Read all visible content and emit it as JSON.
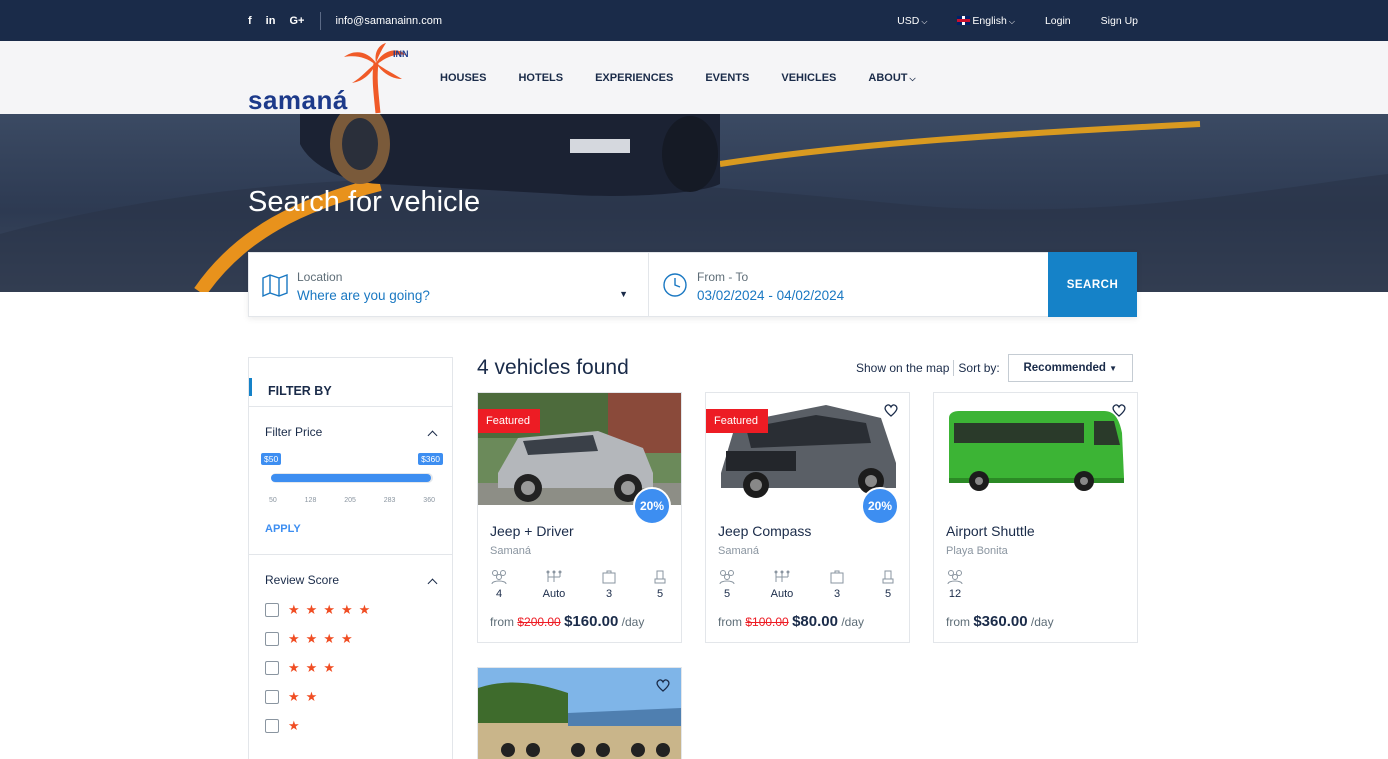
{
  "topbar": {
    "social": [
      "f",
      "in",
      "G+"
    ],
    "email": "info@samanainn.com",
    "currency": "USD",
    "language": "English",
    "login": "Login",
    "signup": "Sign Up"
  },
  "header": {
    "logo_text": "samaná",
    "logo_sup": "INN",
    "nav": [
      "HOUSES",
      "HOTELS",
      "EXPERIENCES",
      "EVENTS",
      "VEHICLES",
      "ABOUT"
    ]
  },
  "hero": {
    "title": "Search for vehicle"
  },
  "search": {
    "location_label": "Location",
    "location_value": "Where are you going?",
    "date_label": "From - To",
    "date_value": "03/02/2024 - 04/02/2024",
    "button": "SEARCH"
  },
  "sidebar": {
    "filter_by": "FILTER BY",
    "price_title": "Filter Price",
    "price_min_tag": "$50",
    "price_max_tag": "$360",
    "price_ticks": [
      "50",
      "128",
      "205",
      "283",
      "360"
    ],
    "apply": "APPLY",
    "review_title": "Review Score",
    "review_levels": [
      5,
      4,
      3,
      2,
      1
    ]
  },
  "results": {
    "count_text": "4 vehicles found",
    "show_map": "Show on the map",
    "sort_label": "Sort by:",
    "sort_value": "Recommended",
    "cards": [
      {
        "title": "Jeep + Driver",
        "location": "Samaná",
        "featured": "Featured",
        "discount": "20%",
        "specs": [
          "4",
          "Auto",
          "3",
          "5"
        ],
        "from": "from",
        "old_price": "$200.00",
        "price": "$160.00",
        "unit": "/day"
      },
      {
        "title": "Jeep Compass",
        "location": "Samaná",
        "featured": "Featured",
        "discount": "20%",
        "specs": [
          "5",
          "Auto",
          "3",
          "5"
        ],
        "from": "from",
        "old_price": "$100.00",
        "price": "$80.00",
        "unit": "/day"
      },
      {
        "title": "Airport Shuttle",
        "location": "Playa Bonita",
        "specs": [
          "12"
        ],
        "from": "from",
        "price": "$360.00",
        "unit": "/day"
      }
    ]
  },
  "colors": {
    "primary": "#1582c8",
    "accent_blue": "#3d8ef1",
    "navy": "#1a2b49",
    "featured_red": "#ed1c24",
    "star": "#f04d23",
    "logo_orange": "#f05a28",
    "bus_green": "#3cb435"
  }
}
